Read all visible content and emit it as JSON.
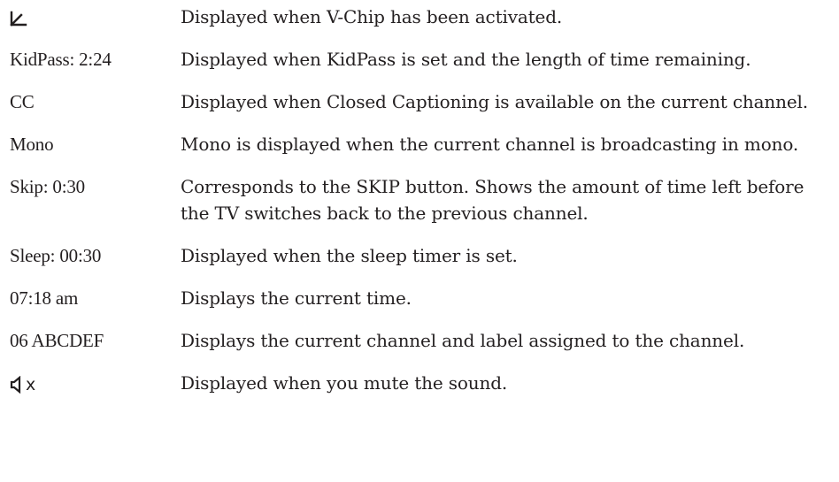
{
  "rows": [
    {
      "term_icon": "vchip-lock-icon",
      "description": "Displayed when V-Chip has been activated."
    },
    {
      "term": "KidPass: 2:24",
      "description": "Displayed when KidPass is set and the length of time remaining."
    },
    {
      "term": "CC",
      "description": "Displayed when Closed Captioning is available on the current channel."
    },
    {
      "term": "Mono",
      "description": "Mono is displayed when the current channel is broadcasting in mono."
    },
    {
      "term": "Skip: 0:30",
      "description": "Corresponds to the SKIP button. Shows the amount of time left before the TV switches back to the previous channel."
    },
    {
      "term": "Sleep: 00:30",
      "description": "Displayed when the sleep timer is set."
    },
    {
      "term": "07:18 am",
      "description": "Displays the current time."
    },
    {
      "term": "06 ABCDEF",
      "description": "Displays the current channel and label assigned to the channel."
    },
    {
      "term_icon": "mute-speaker-icon",
      "term_suffix": "x",
      "description": "Displayed when you mute the sound."
    }
  ]
}
